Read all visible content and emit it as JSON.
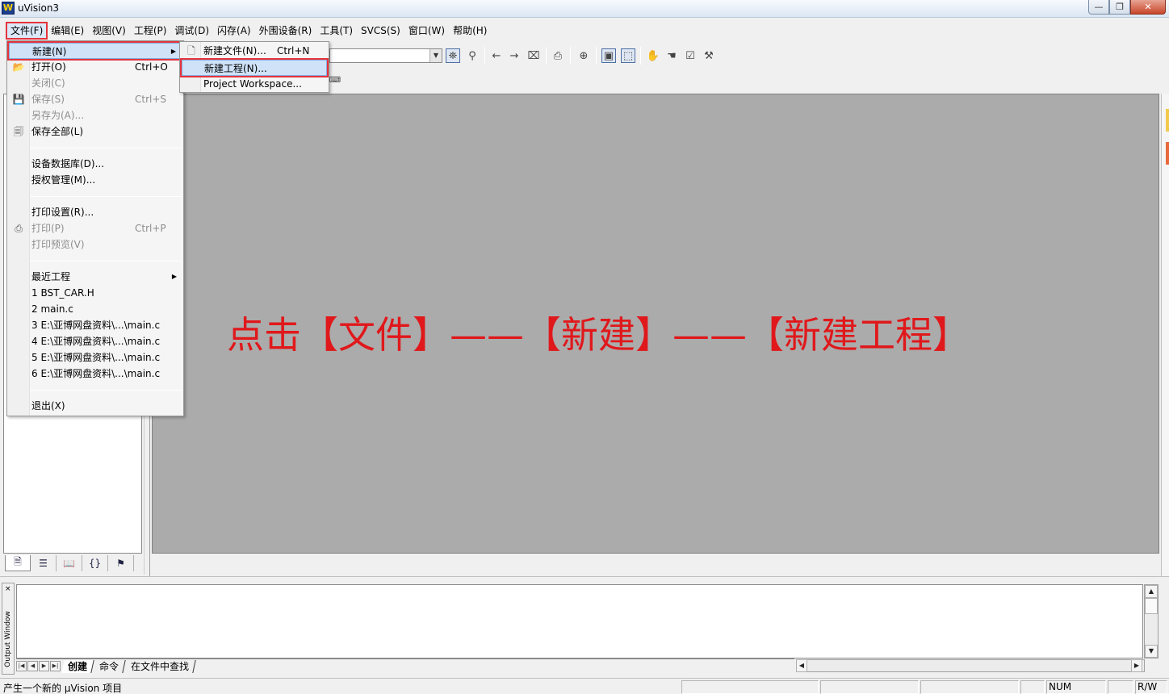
{
  "window": {
    "title": "uVision3",
    "icon_letter": "W",
    "controls": {
      "minimize": "—",
      "maximize": "❐",
      "close": "✕"
    }
  },
  "menubar": [
    "文件(F)",
    "编辑(E)",
    "视图(V)",
    "工程(P)",
    "调试(D)",
    "闪存(A)",
    "外围设备(R)",
    "工具(T)",
    "SVCS(S)",
    "窗口(W)",
    "帮助(H)"
  ],
  "file_menu": {
    "items": [
      {
        "label": "新建(N)",
        "shortcut": "",
        "disabled": false,
        "submenu": true,
        "highlighted": true,
        "icon": ""
      },
      {
        "label": "打开(O)",
        "shortcut": "Ctrl+O",
        "disabled": false,
        "icon": "open-folder-icon"
      },
      {
        "label": "关闭(C)",
        "shortcut": "",
        "disabled": true,
        "icon": ""
      },
      {
        "label": "保存(S)",
        "shortcut": "Ctrl+S",
        "disabled": true,
        "icon": "save-icon"
      },
      {
        "label": "另存为(A)...",
        "shortcut": "",
        "disabled": true,
        "icon": ""
      },
      {
        "label": "保存全部(L)",
        "shortcut": "",
        "disabled": false,
        "icon": "save-all-icon"
      },
      {
        "label": "设备数据库(D)...",
        "shortcut": "",
        "disabled": false,
        "icon": ""
      },
      {
        "label": "授权管理(M)...",
        "shortcut": "",
        "disabled": false,
        "icon": ""
      },
      {
        "label": "打印设置(R)...",
        "shortcut": "",
        "disabled": false,
        "icon": ""
      },
      {
        "label": "打印(P)",
        "shortcut": "Ctrl+P",
        "disabled": true,
        "icon": "print-icon"
      },
      {
        "label": "打印预览(V)",
        "shortcut": "",
        "disabled": true,
        "icon": ""
      },
      {
        "label": "最近工程",
        "shortcut": "",
        "disabled": false,
        "submenu": true,
        "icon": ""
      },
      {
        "label": "1 BST_CAR.H",
        "shortcut": "",
        "disabled": false,
        "icon": ""
      },
      {
        "label": "2 main.c",
        "shortcut": "",
        "disabled": false,
        "icon": ""
      },
      {
        "label": "3 E:\\亚博网盘资料\\...\\main.c",
        "shortcut": "",
        "disabled": false,
        "icon": ""
      },
      {
        "label": "4 E:\\亚博网盘资料\\...\\main.c",
        "shortcut": "",
        "disabled": false,
        "icon": ""
      },
      {
        "label": "5 E:\\亚博网盘资料\\...\\main.c",
        "shortcut": "",
        "disabled": false,
        "icon": ""
      },
      {
        "label": "6 E:\\亚博网盘资料\\...\\main.c",
        "shortcut": "",
        "disabled": false,
        "icon": ""
      },
      {
        "label": "退出(X)",
        "shortcut": "",
        "disabled": false,
        "icon": ""
      }
    ]
  },
  "new_submenu": {
    "items": [
      {
        "label": "新建文件(N)...",
        "shortcut": "Ctrl+N",
        "icon": "new-file-icon",
        "highlighted": false
      },
      {
        "label": "新建工程(N)...",
        "shortcut": "",
        "icon": "",
        "highlighted": true
      },
      {
        "label": "Project Workspace...",
        "shortcut": "",
        "icon": "",
        "highlighted": false
      }
    ]
  },
  "annotation": "点击【文件】——【新建】——【新建工程】",
  "output": {
    "side_label": "Output Window",
    "close": "×",
    "tabs": [
      "创建",
      "命令",
      "在文件中查找"
    ],
    "active_tab": "创建"
  },
  "statusbar": {
    "message": "产生一个新的 μVision 项目",
    "num": "NUM",
    "rw": "R/W"
  },
  "colors": {
    "annotation": "#e0181b",
    "highlight_border": "#e5343c",
    "client_bg": "#ababab"
  }
}
